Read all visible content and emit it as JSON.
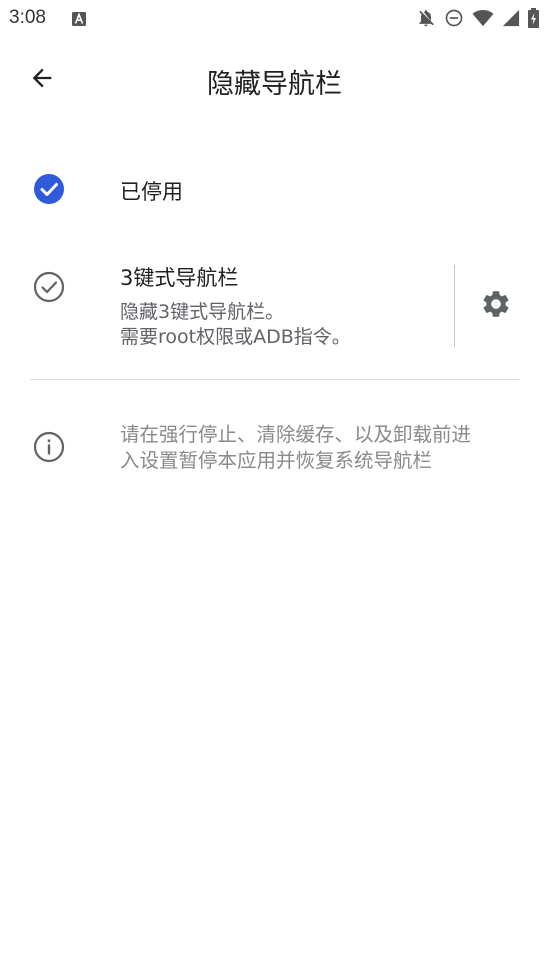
{
  "status_bar": {
    "time": "3:08",
    "icons": [
      "notification-a-icon",
      "notifications-off-icon",
      "do-not-disturb-icon",
      "wifi-icon",
      "cellular-signal-icon",
      "battery-charging-icon"
    ]
  },
  "toolbar": {
    "back_icon": "arrow-back-icon",
    "title": "隐藏导航栏"
  },
  "options": [
    {
      "title": "已停用",
      "selected": true,
      "icon": "check-circle-filled-icon"
    },
    {
      "title": "3键式导航栏",
      "summary_line1": "隐藏3键式导航栏。",
      "summary_line2": "需要root权限或ADB指令。",
      "selected": false,
      "icon": "check-circle-outline-icon",
      "action_icon": "gear-icon"
    }
  ],
  "info": {
    "icon": "info-outline-icon",
    "line1": "请在强行停止、清除缓存、以及卸载前进",
    "line2": "入设置暂停本应用并恢复系统导航栏"
  },
  "colors": {
    "accent": "#2f5bdb",
    "icon_gray": "#5f6368",
    "text_primary": "#202124",
    "text_secondary": "#5f6368",
    "text_info": "#8a8a8a"
  }
}
